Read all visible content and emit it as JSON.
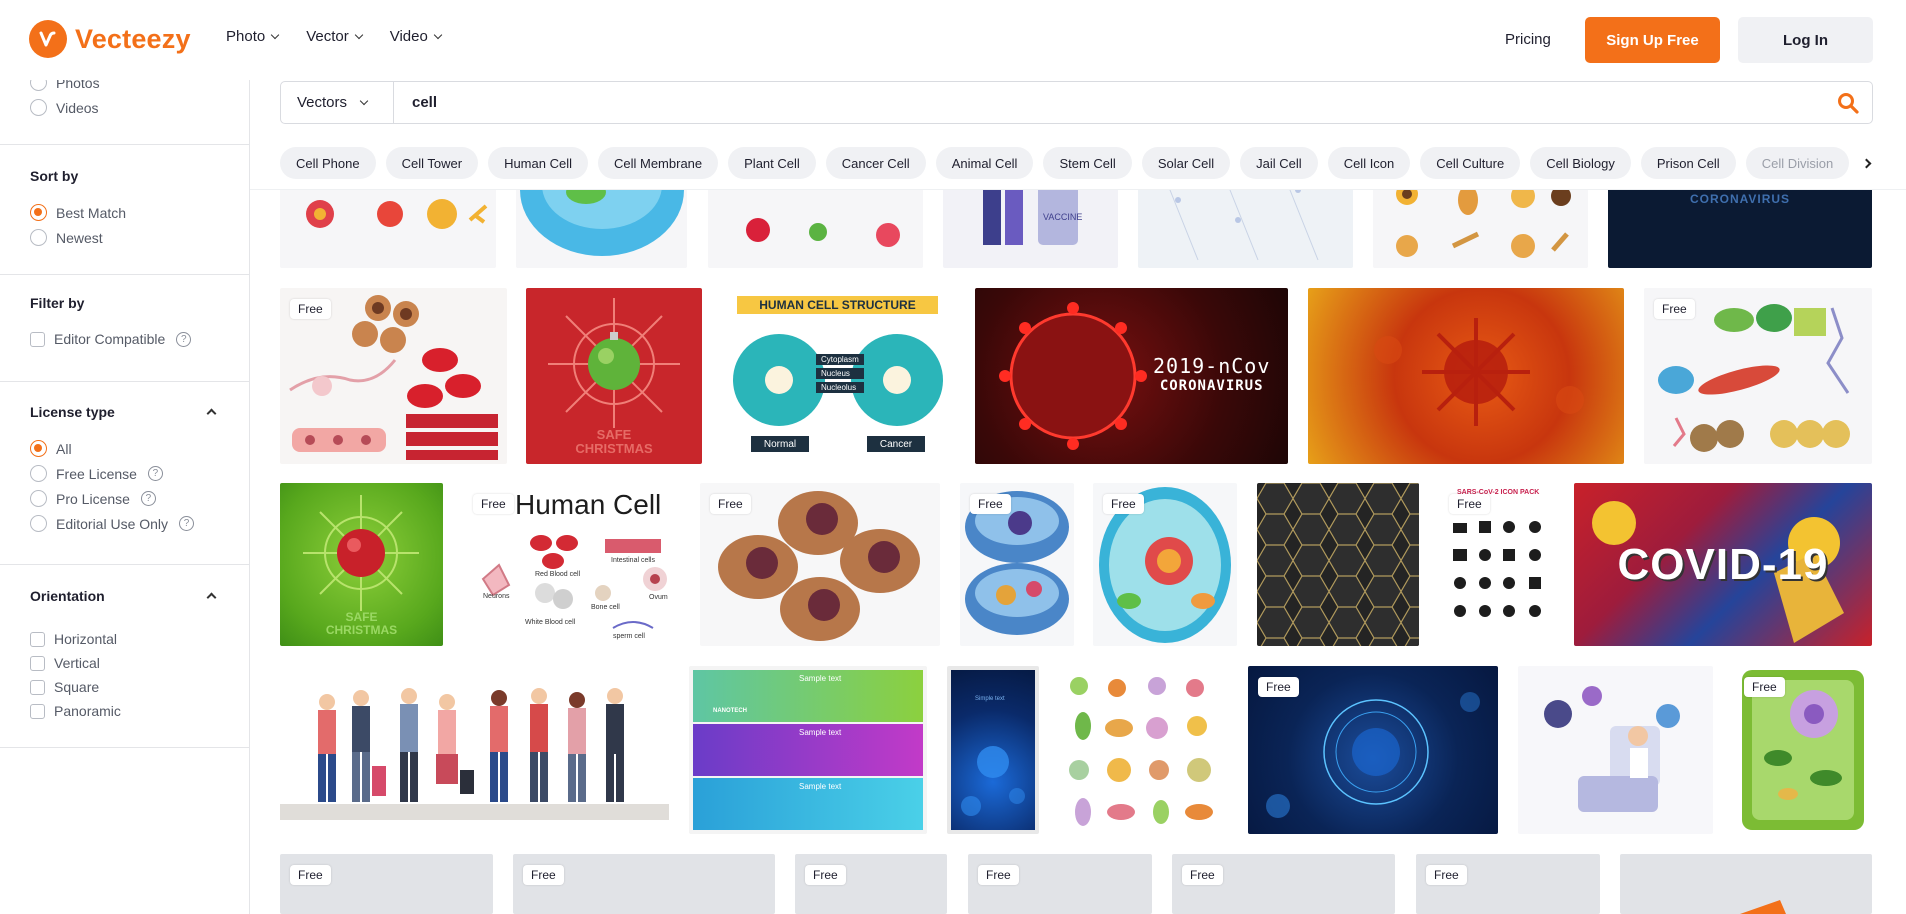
{
  "brand": {
    "name": "Vecteezy",
    "accent": "#f37019"
  },
  "nav": {
    "items": [
      {
        "label": "Photo"
      },
      {
        "label": "Vector"
      },
      {
        "label": "Video"
      }
    ]
  },
  "header": {
    "pricing": "Pricing",
    "signup": "Sign Up Free",
    "login": "Log In"
  },
  "sidebar": {
    "asset_types": [
      "Photos",
      "Videos"
    ],
    "sort_by": {
      "title": "Sort by",
      "options": [
        "Best Match",
        "Newest"
      ],
      "selected": "Best Match"
    },
    "filter_by": {
      "title": "Filter by",
      "options": [
        "Editor Compatible"
      ]
    },
    "license": {
      "title": "License type",
      "options": [
        "All",
        "Free License",
        "Pro License",
        "Editorial Use Only"
      ],
      "selected": "All"
    },
    "orientation": {
      "title": "Orientation",
      "options": [
        "Horizontal",
        "Vertical",
        "Square",
        "Panoramic"
      ]
    }
  },
  "search": {
    "type": "Vectors",
    "query": "cell"
  },
  "chips": [
    "Cell Phone",
    "Cell Tower",
    "Human Cell",
    "Cell Membrane",
    "Plant Cell",
    "Cancer Cell",
    "Animal Cell",
    "Stem Cell",
    "Solar Cell",
    "Jail Cell",
    "Cell Icon",
    "Cell Culture",
    "Cell Biology",
    "Prison Cell",
    "Cell Division"
  ],
  "badge_free": "Free",
  "tiles": {
    "human_cell_structure": {
      "title": "HUMAN CELL STRUCTURE",
      "labels": [
        "Cytoplasm",
        "Nucleus",
        "Nucleolus"
      ],
      "normal": "Normal",
      "cancer": "Cancer"
    },
    "ncov": {
      "line1": "2019-nCov",
      "line2": "CORONAVIRUS"
    },
    "christmas": {
      "line1": "SAFE",
      "line2": "CHRISTMAS"
    },
    "human_cell": {
      "title": "Human Cell",
      "labels": [
        "Red Blood cell",
        "Intestinal cells",
        "Neurons",
        "Bone cell",
        "Ovum",
        "White Blood cell",
        "sperm cell"
      ]
    },
    "icon_pack": "SARS-CoV-2  ICON PACK",
    "covid": "COVID-19",
    "nanotech": {
      "sample": "Sample text",
      "brand": "NANOTECH"
    },
    "coronavirus_top": "CORONAVIRUS",
    "vaccine": "VACCINE",
    "sample_text_small": "Simple text"
  }
}
